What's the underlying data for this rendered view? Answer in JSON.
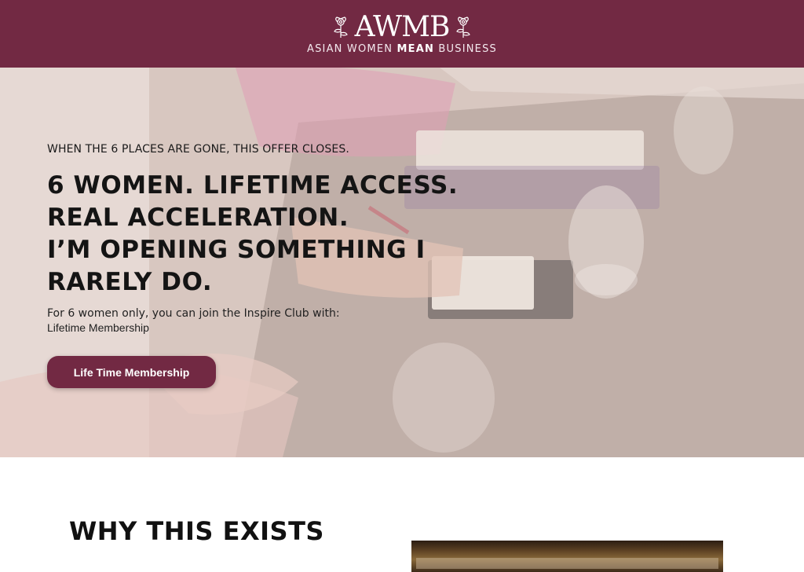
{
  "header": {
    "logo_text": "AWMB",
    "tagline_part1": "ASIAN WOMEN ",
    "tagline_bold": "MEAN",
    "tagline_part2": " BUSINESS",
    "background_color": "#722943"
  },
  "hero": {
    "eyebrow": "WHEN THE 6 PLACES ARE GONE, THIS OFFER CLOSES.",
    "headline_lines": [
      "6 WOMEN. LIFETIME ACCESS.",
      "REAL ACCELERATION.",
      "I’M OPENING SOMETHING I",
      "RARELY DO."
    ],
    "subtext": "For 6 women only, you can join the Inspire Club with:",
    "subtext_item": "Lifetime Membership",
    "cta_label": "Life Time Membership"
  },
  "why_section": {
    "title": "WHY THIS EXISTS"
  },
  "colors": {
    "brand": "#722943",
    "text": "#141414"
  },
  "icons": [
    "flower-left-icon",
    "flower-right-icon"
  ]
}
